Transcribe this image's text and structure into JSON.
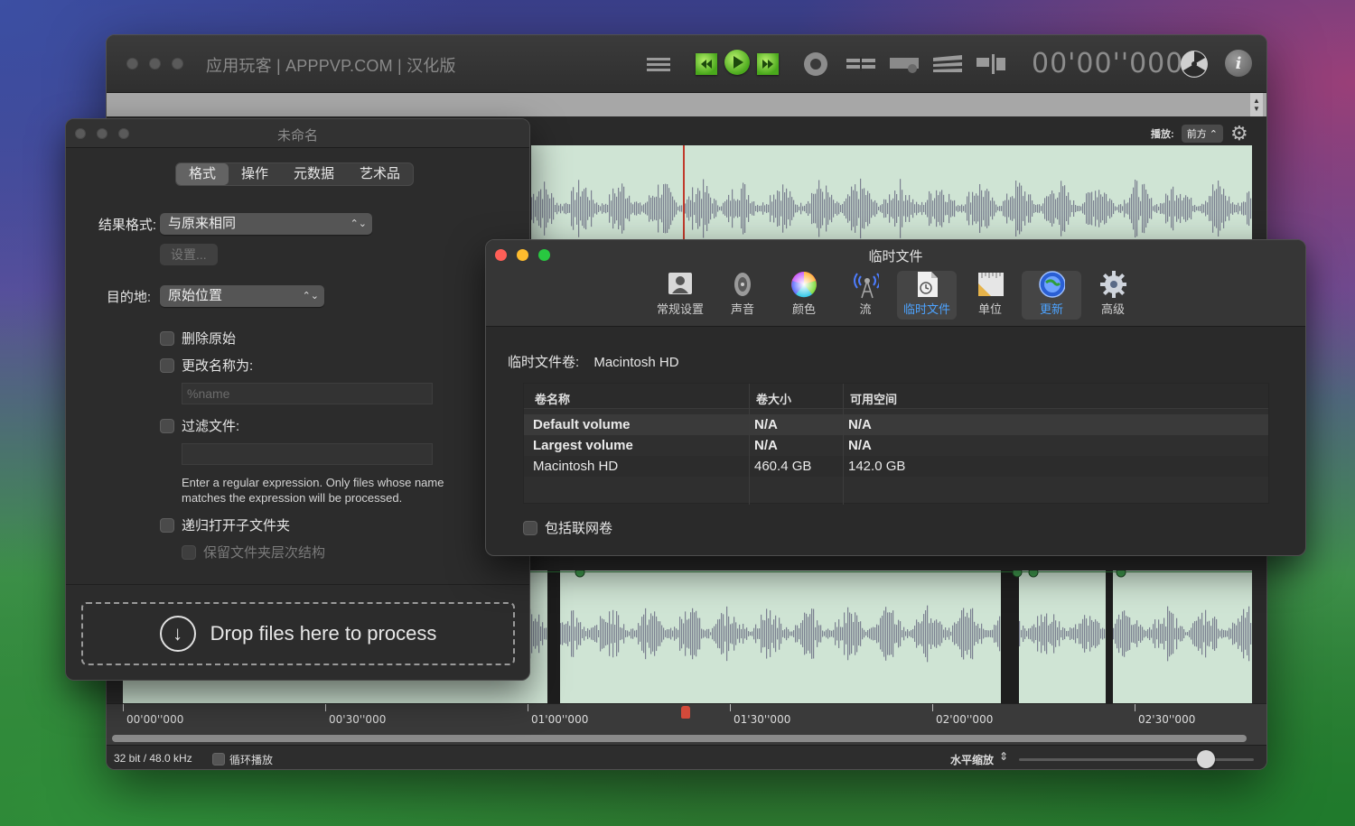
{
  "main": {
    "title": "应用玩客 | APPPVP.COM | 汉化版",
    "timecode": "00'00''000",
    "play_label": "播放:",
    "play_select": "前方",
    "ruler_labels": [
      "00'00''000",
      "00'30''000",
      "01'00''000",
      "01'30''000",
      "02'00''000",
      "02'30''000"
    ],
    "status_format": "32 bit / 48.0 kHz",
    "loop_label": "循环播放",
    "zoom_label": "水平缩放",
    "zoom_value": 0.82
  },
  "left_panel": {
    "title": "未命名",
    "tabs": [
      "格式",
      "操作",
      "元数据",
      "艺术品"
    ],
    "active_tab": "格式",
    "result_format_label": "结果格式:",
    "result_format_value": "与原来相同",
    "settings_button": "设置...",
    "destination_label": "目的地:",
    "destination_value": "原始位置",
    "delete_original": "删除原始",
    "rename_to": "更改名称为:",
    "rename_placeholder": "%name",
    "filter_files": "过滤文件:",
    "hint": "Enter a regular expression. Only files whose name matches the expression will be processed.",
    "recursive": "递归打开子文件夹",
    "keep_hierarchy": "保留文件夹层次结构",
    "drop_text": "Drop files here to process"
  },
  "prefs": {
    "title": "临时文件",
    "toolbar": [
      {
        "label": "常规设置",
        "icon": "general-icon"
      },
      {
        "label": "声音",
        "icon": "speaker-icon"
      },
      {
        "label": "颜色",
        "icon": "color-wheel-icon"
      },
      {
        "label": "流",
        "icon": "stream-antenna-icon"
      },
      {
        "label": "临时文件",
        "icon": "temp-file-icon"
      },
      {
        "label": "单位",
        "icon": "ruler-units-icon"
      },
      {
        "label": "更新",
        "icon": "update-globe-icon"
      },
      {
        "label": "高级",
        "icon": "advanced-gear-icon"
      }
    ],
    "active_tool": "临时文件",
    "volume_label": "临时文件卷:",
    "volume_value": "Macintosh HD",
    "columns": [
      "卷名称",
      "卷大小",
      "可用空间"
    ],
    "rows": [
      [
        "Default volume",
        "N/A",
        "N/A"
      ],
      [
        "Largest volume",
        "N/A",
        "N/A"
      ],
      [
        "Macintosh HD",
        "460.4 GB",
        "142.0 GB"
      ]
    ],
    "include_network": "包括联网卷"
  },
  "colors": {
    "accent_blue": "#4da3ff",
    "wave_bg": "#cfe4d4",
    "wave_fill": "#7c8191",
    "playhead": "#c0392b"
  }
}
